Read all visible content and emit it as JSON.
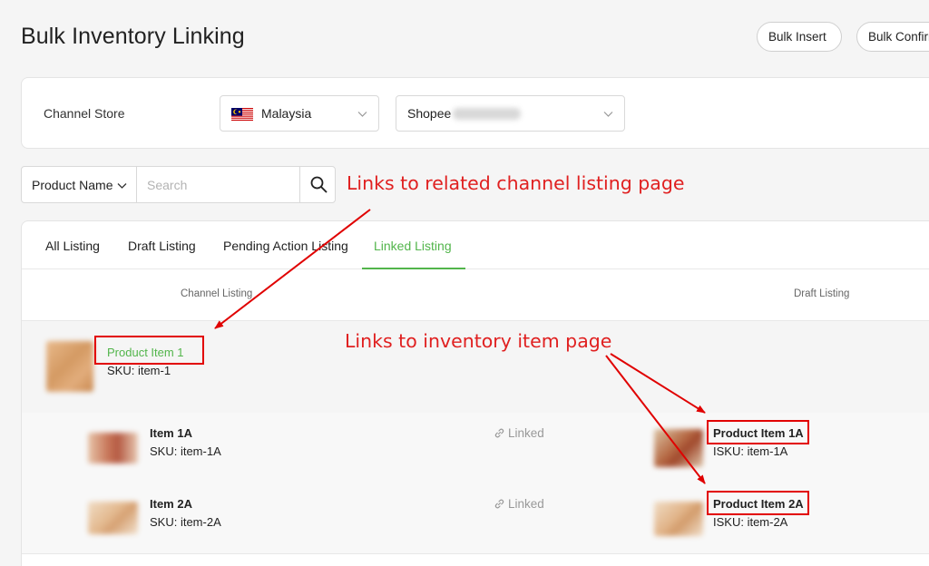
{
  "header": {
    "title": "Bulk Inventory Linking",
    "bulk_insert": "Bulk Insert",
    "bulk_confirm": "Bulk Confirm"
  },
  "channel_store": {
    "label": "Channel Store",
    "country": "Malaysia",
    "store_prefix": "Shopee"
  },
  "search": {
    "field": "Product Name",
    "placeholder": "Search"
  },
  "tabs": [
    {
      "label": "All Listing",
      "active": false
    },
    {
      "label": "Draft Listing",
      "active": false
    },
    {
      "label": "Pending Action Listing",
      "active": false
    },
    {
      "label": "Linked Listing",
      "active": true
    }
  ],
  "columns": {
    "channel": "Channel Listing",
    "draft": "Draft Listing"
  },
  "parent": {
    "name": "Product Item 1",
    "sku": "SKU: item-1"
  },
  "children": [
    {
      "name": "Item 1A",
      "sku": "SKU: item-1A",
      "status": "Linked",
      "inv_name": "Product Item 1A",
      "isku": "ISKU: item-1A"
    },
    {
      "name": "Item 2A",
      "sku": "SKU: item-2A",
      "status": "Linked",
      "inv_name": "Product Item 2A",
      "isku": "ISKU: item-2A"
    }
  ],
  "annotations": {
    "channel_note": "Links to related channel listing page",
    "inventory_note": "Links to inventory item page"
  },
  "colors": {
    "accent_green": "#52b54b",
    "annotation_red": "#e02020"
  }
}
